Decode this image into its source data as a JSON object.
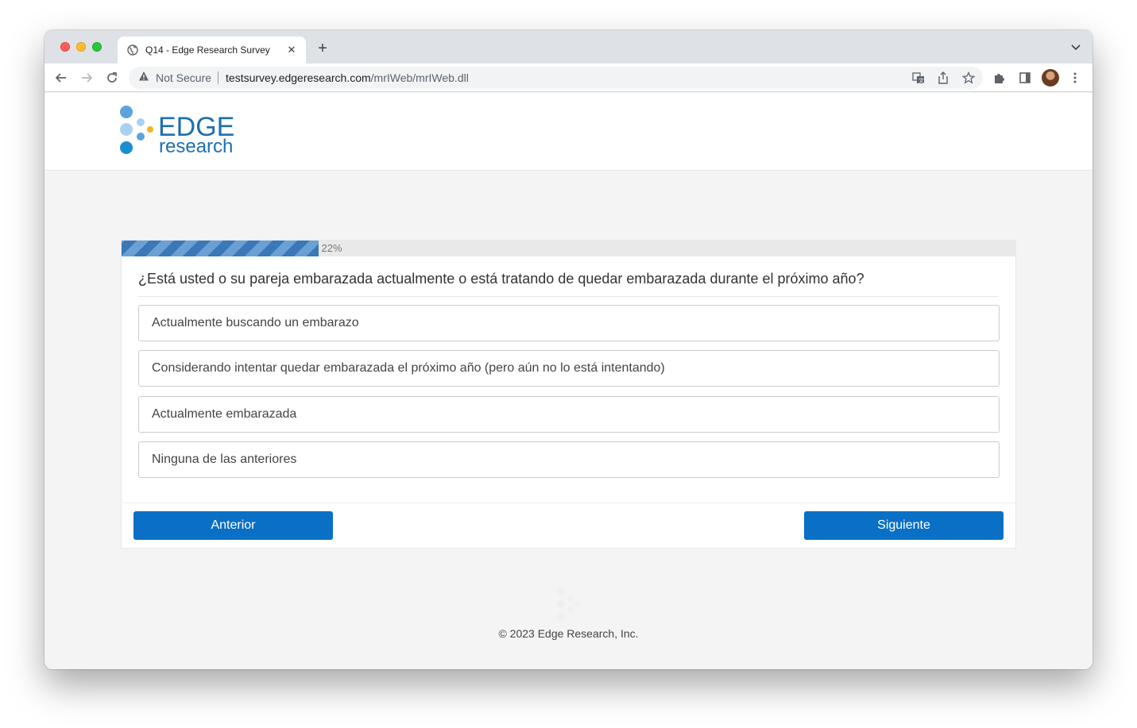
{
  "browser": {
    "tab_title": "Q14 - Edge Research Survey",
    "address_security": "Not Secure",
    "url_host": "testsurvey.edgeresearch.com",
    "url_path": "/mrIWeb/mrIWeb.dll"
  },
  "header": {
    "logo_word1": "EDGE",
    "logo_word2": "research",
    "brand_color": "#1d6fb0"
  },
  "survey": {
    "progress": {
      "percent": 22,
      "label": "22%"
    },
    "question": "¿Está usted o su pareja embarazada actualmente o está tratando de quedar embarazada durante el próximo año?",
    "options": [
      "Actualmente buscando un embarazo",
      "Considerando intentar quedar embarazada el próximo año (pero aún no lo está intentando)",
      "Actualmente embarazada",
      "Ninguna de las anteriores"
    ],
    "prev_label": "Anterior",
    "next_label": "Siguiente",
    "button_color": "#0a70c5"
  },
  "footer": {
    "copyright": "© 2023 Edge Research, Inc."
  }
}
